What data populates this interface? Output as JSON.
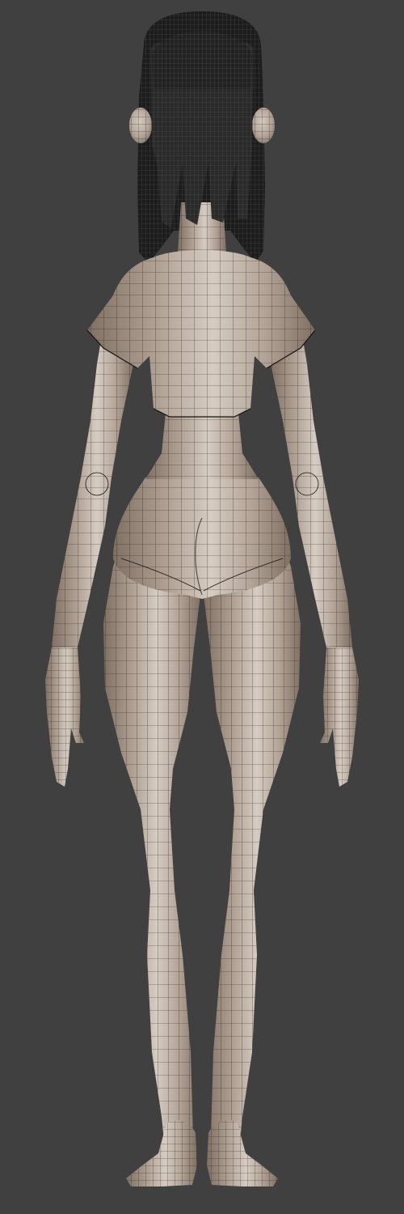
{
  "scene": {
    "subject": "character-model-back-view",
    "colors": {
      "background": "#404040",
      "skin_light": "#d6ccc2",
      "skin_mid": "#b2a396",
      "skin_dark": "#7f7063",
      "wire": "#161310",
      "hair": "#1c1c1c",
      "hair_wire": "#545454"
    }
  }
}
